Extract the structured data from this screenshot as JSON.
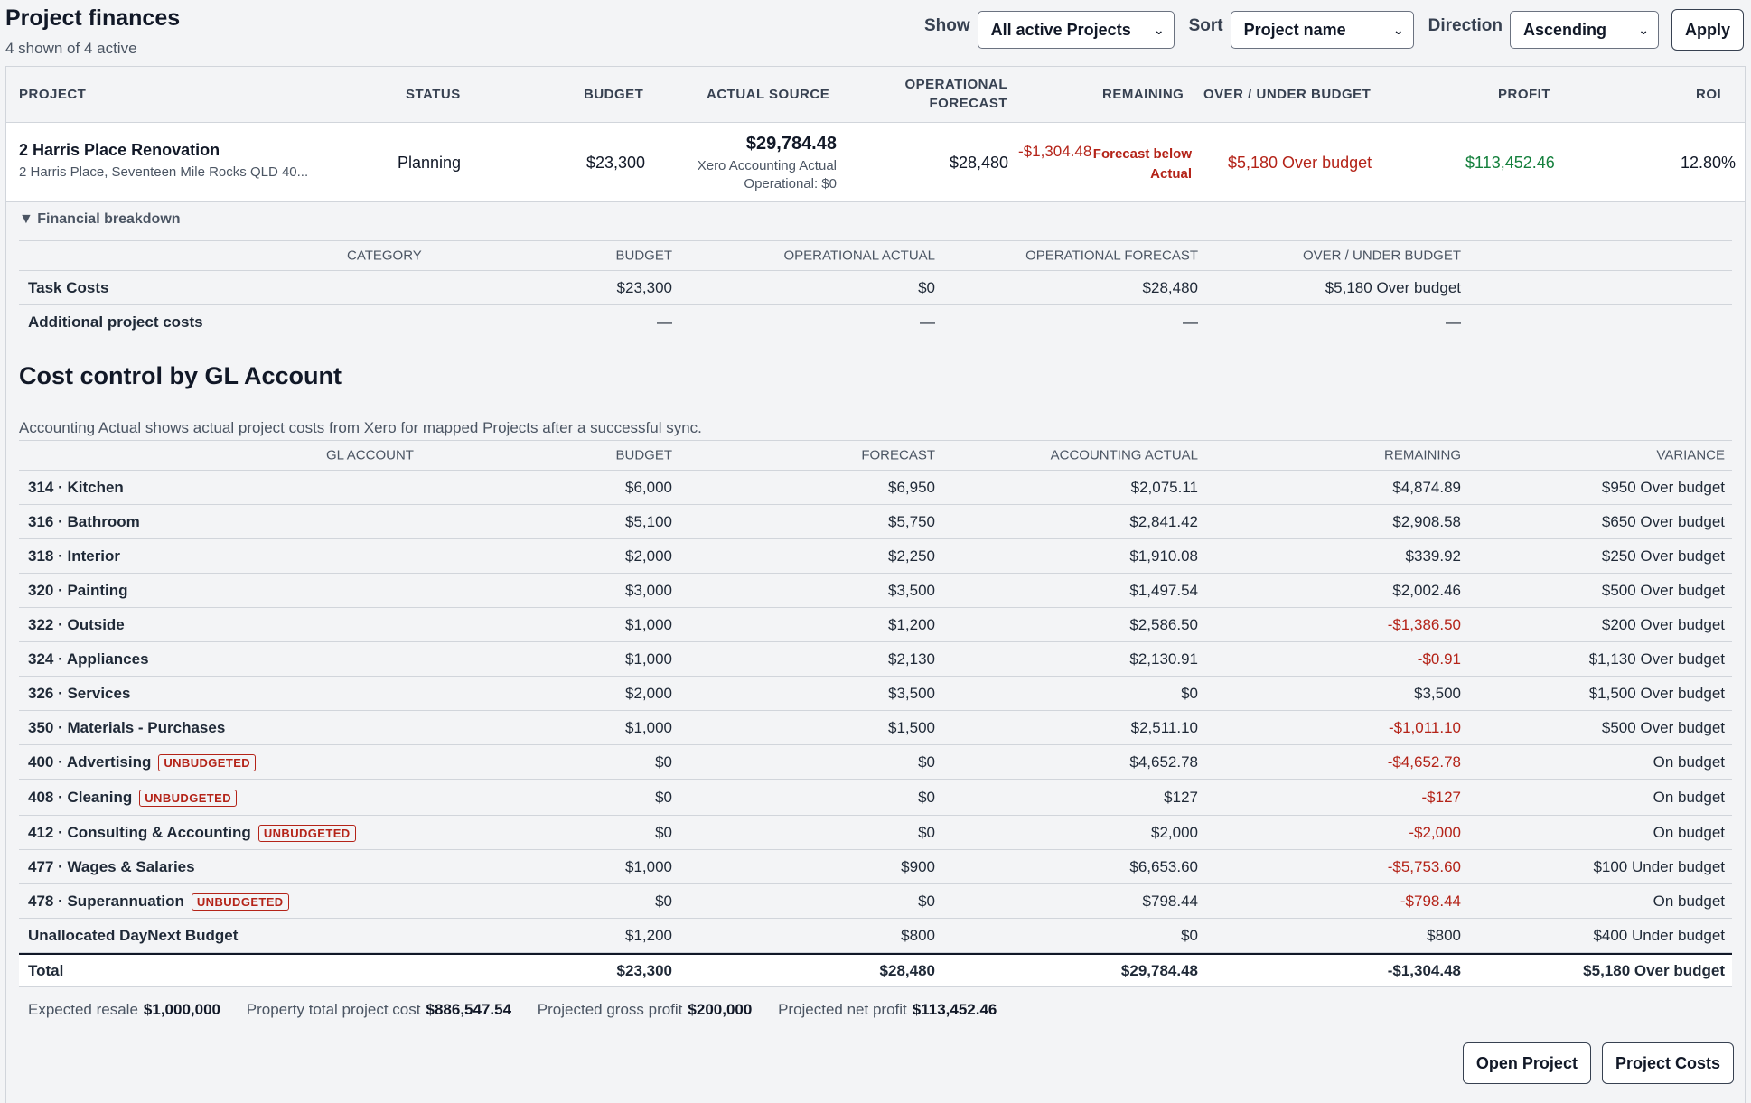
{
  "header": {
    "title": "Project finances",
    "subtitle": "4 shown of 4 active"
  },
  "filters": {
    "show_label": "Show",
    "show_value": "All active Projects",
    "sort_label": "Sort",
    "sort_value": "Project name",
    "direction_label": "Direction",
    "direction_value": "Ascending",
    "apply_label": "Apply"
  },
  "projects_table": {
    "headers": {
      "project": "PROJECT",
      "status": "STATUS",
      "budget": "BUDGET",
      "actual_source": "ACTUAL SOURCE",
      "operational_forecast_1": "OPERATIONAL",
      "operational_forecast_2": "FORECAST",
      "remaining": "REMAINING",
      "over_under": "OVER / UNDER BUDGET",
      "profit": "PROFIT",
      "roi": "ROI"
    },
    "project": {
      "name": "2 Harris Place Renovation",
      "address": "2 Harris Place, Seventeen Mile Rocks QLD 40...",
      "status": "Planning",
      "budget": "$23,300",
      "actual_value": "$29,784.48",
      "actual_source": "Xero Accounting Actual",
      "actual_operational": "Operational: $0",
      "operational_forecast": "$28,480",
      "remaining_value": "-$1,304.48",
      "remaining_note_1": "Forecast below",
      "remaining_note_2": "Actual",
      "over_under": "$5,180 Over budget",
      "profit": "$113,452.46",
      "roi": "12.80%"
    }
  },
  "breakdown": {
    "toggle_label": "▼ Financial breakdown",
    "headers": {
      "category": "CATEGORY",
      "budget": "BUDGET",
      "operational_actual": "OPERATIONAL ACTUAL",
      "operational_forecast": "OPERATIONAL FORECAST",
      "over_under": "OVER / UNDER BUDGET"
    },
    "rows": [
      {
        "category": "Task Costs",
        "budget": "$23,300",
        "actual": "$0",
        "forecast": "$28,480",
        "over_under": "$5,180 Over budget"
      },
      {
        "category": "Additional project costs",
        "budget": "—",
        "actual": "—",
        "forecast": "—",
        "over_under": "—"
      }
    ]
  },
  "gl": {
    "title": "Cost control by GL Account",
    "description": "Accounting Actual shows actual project costs from Xero for mapped Projects after a successful sync.",
    "badge_text": "UNBUDGETED",
    "headers": {
      "account": "GL ACCOUNT",
      "budget": "BUDGET",
      "forecast": "FORECAST",
      "actual": "ACCOUNTING ACTUAL",
      "remaining": "REMAINING",
      "variance": "VARIANCE"
    },
    "rows": [
      {
        "account": "314 · Kitchen",
        "budget": "$6,000",
        "forecast": "$6,950",
        "actual": "$2,075.11",
        "remaining": "$4,874.89",
        "variance": "$950 Over budget"
      },
      {
        "account": "316 · Bathroom",
        "budget": "$5,100",
        "forecast": "$5,750",
        "actual": "$2,841.42",
        "remaining": "$2,908.58",
        "variance": "$650 Over budget"
      },
      {
        "account": "318 · Interior",
        "budget": "$2,000",
        "forecast": "$2,250",
        "actual": "$1,910.08",
        "remaining": "$339.92",
        "variance": "$250 Over budget"
      },
      {
        "account": "320 · Painting",
        "budget": "$3,000",
        "forecast": "$3,500",
        "actual": "$1,497.54",
        "remaining": "$2,002.46",
        "variance": "$500 Over budget"
      },
      {
        "account": "322 · Outside",
        "budget": "$1,000",
        "forecast": "$1,200",
        "actual": "$2,586.50",
        "remaining": "-$1,386.50",
        "variance": "$200 Over budget"
      },
      {
        "account": "324 · Appliances",
        "budget": "$1,000",
        "forecast": "$2,130",
        "actual": "$2,130.91",
        "remaining": "-$0.91",
        "variance": "$1,130 Over budget"
      },
      {
        "account": "326 · Services",
        "budget": "$2,000",
        "forecast": "$3,500",
        "actual": "$0",
        "remaining": "$3,500",
        "variance": "$1,500 Over budget"
      },
      {
        "account": "350 · Materials - Purchases",
        "budget": "$1,000",
        "forecast": "$1,500",
        "actual": "$2,511.10",
        "remaining": "-$1,011.10",
        "variance": "$500 Over budget"
      },
      {
        "account": "400 · Advertising",
        "unbudgeted": true,
        "budget": "$0",
        "forecast": "$0",
        "actual": "$4,652.78",
        "remaining": "-$4,652.78",
        "variance": "On budget"
      },
      {
        "account": "408 · Cleaning",
        "unbudgeted": true,
        "budget": "$0",
        "forecast": "$0",
        "actual": "$127",
        "remaining": "-$127",
        "variance": "On budget"
      },
      {
        "account": "412 · Consulting & Accounting",
        "unbudgeted": true,
        "budget": "$0",
        "forecast": "$0",
        "actual": "$2,000",
        "remaining": "-$2,000",
        "variance": "On budget"
      },
      {
        "account": "477 · Wages & Salaries",
        "budget": "$1,000",
        "forecast": "$900",
        "actual": "$6,653.60",
        "remaining": "-$5,753.60",
        "variance": "$100 Under budget"
      },
      {
        "account": "478 · Superannuation",
        "unbudgeted": true,
        "budget": "$0",
        "forecast": "$0",
        "actual": "$798.44",
        "remaining": "-$798.44",
        "variance": "On budget"
      },
      {
        "account": "Unallocated DayNext Budget",
        "budget": "$1,200",
        "forecast": "$800",
        "actual": "$0",
        "remaining": "$800",
        "variance": "$400 Under budget"
      }
    ],
    "total": {
      "account": "Total",
      "budget": "$23,300",
      "forecast": "$28,480",
      "actual": "$29,784.48",
      "remaining": "-$1,304.48",
      "variance": "$5,180 Over budget"
    }
  },
  "summary": {
    "resale_label": "Expected resale",
    "resale_value": "$1,000,000",
    "total_cost_label": "Property total project cost",
    "total_cost_value": "$886,547.54",
    "gross_label": "Projected gross profit",
    "gross_value": "$200,000",
    "net_label": "Projected net profit",
    "net_value": "$113,452.46"
  },
  "actions": {
    "open_project": "Open Project",
    "project_costs": "Project Costs"
  },
  "colors": {
    "negative": "#b42318",
    "positive": "#15803d"
  }
}
